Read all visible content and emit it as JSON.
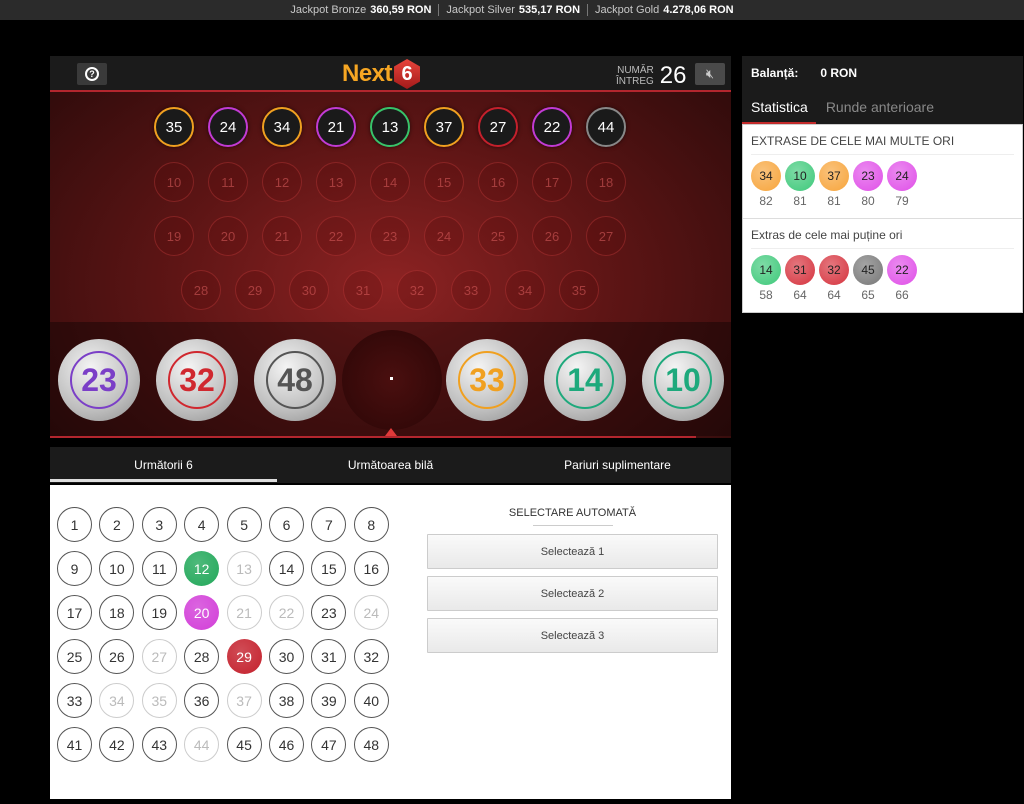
{
  "jackpots": [
    {
      "label": "Jackpot Bronze",
      "value": "360,59 RON"
    },
    {
      "label": "Jackpot Silver",
      "value": "535,17 RON"
    },
    {
      "label": "Jackpot Gold",
      "value": "4.278,06 RON"
    }
  ],
  "game": {
    "logo_text": "Next",
    "logo_number": "6",
    "round_label_1": "Număr",
    "round_label_2": "întreg",
    "round_number": "26",
    "help_icon": "question-icon",
    "mute_icon": "speaker-muted-icon",
    "drawn_balls": [
      {
        "n": "35",
        "color": "#f0a020"
      },
      {
        "n": "24",
        "color": "#c23bd4"
      },
      {
        "n": "34",
        "color": "#f0a020"
      },
      {
        "n": "21",
        "color": "#c23bd4"
      },
      {
        "n": "13",
        "color": "#38c36a"
      },
      {
        "n": "37",
        "color": "#f0a020"
      },
      {
        "n": "27",
        "color": "#c4202c"
      },
      {
        "n": "22",
        "color": "#c23bd4"
      },
      {
        "n": "44",
        "color": "#888888"
      }
    ],
    "slots_row1": [
      "10",
      "11",
      "12",
      "13",
      "14",
      "15",
      "16",
      "17",
      "18"
    ],
    "slots_row2": [
      "19",
      "20",
      "21",
      "22",
      "23",
      "24",
      "25",
      "26",
      "27"
    ],
    "slots_row3": [
      "28",
      "29",
      "30",
      "31",
      "32",
      "33",
      "34",
      "35"
    ],
    "tray_balls": [
      {
        "n": "23",
        "color": "#7b3fc7"
      },
      {
        "n": "32",
        "color": "#d0282f"
      },
      {
        "n": "48",
        "color": "#555555"
      },
      {
        "n": "33",
        "color": "#f0a020"
      },
      {
        "n": "14",
        "color": "#1ea97c"
      },
      {
        "n": "10",
        "color": "#1ea97c"
      }
    ]
  },
  "tabs": [
    "Următorii 6",
    "Următoarea bilă",
    "Pariuri suplimentare"
  ],
  "board": {
    "numbers": [
      {
        "n": "1",
        "s": "n"
      },
      {
        "n": "2",
        "s": "n"
      },
      {
        "n": "3",
        "s": "n"
      },
      {
        "n": "4",
        "s": "n"
      },
      {
        "n": "5",
        "s": "n"
      },
      {
        "n": "6",
        "s": "n"
      },
      {
        "n": "7",
        "s": "n"
      },
      {
        "n": "8",
        "s": "n"
      },
      {
        "n": "9",
        "s": "n"
      },
      {
        "n": "10",
        "s": "n"
      },
      {
        "n": "11",
        "s": "n"
      },
      {
        "n": "12",
        "s": "sel",
        "color": "#22a85a"
      },
      {
        "n": "13",
        "s": "dim"
      },
      {
        "n": "14",
        "s": "n"
      },
      {
        "n": "15",
        "s": "n"
      },
      {
        "n": "16",
        "s": "n"
      },
      {
        "n": "17",
        "s": "n"
      },
      {
        "n": "18",
        "s": "n"
      },
      {
        "n": "19",
        "s": "n"
      },
      {
        "n": "20",
        "s": "sel",
        "color": "#d23ed8"
      },
      {
        "n": "21",
        "s": "dim"
      },
      {
        "n": "22",
        "s": "dim"
      },
      {
        "n": "23",
        "s": "n"
      },
      {
        "n": "24",
        "s": "dim"
      },
      {
        "n": "25",
        "s": "n"
      },
      {
        "n": "26",
        "s": "n"
      },
      {
        "n": "27",
        "s": "dim"
      },
      {
        "n": "28",
        "s": "n"
      },
      {
        "n": "29",
        "s": "sel",
        "color": "#c4202c"
      },
      {
        "n": "30",
        "s": "n"
      },
      {
        "n": "31",
        "s": "n"
      },
      {
        "n": "32",
        "s": "n"
      },
      {
        "n": "33",
        "s": "n"
      },
      {
        "n": "34",
        "s": "dim"
      },
      {
        "n": "35",
        "s": "dim"
      },
      {
        "n": "36",
        "s": "n"
      },
      {
        "n": "37",
        "s": "dim"
      },
      {
        "n": "38",
        "s": "n"
      },
      {
        "n": "39",
        "s": "n"
      },
      {
        "n": "40",
        "s": "n"
      },
      {
        "n": "41",
        "s": "n"
      },
      {
        "n": "42",
        "s": "n"
      },
      {
        "n": "43",
        "s": "n"
      },
      {
        "n": "44",
        "s": "dim"
      },
      {
        "n": "45",
        "s": "n"
      },
      {
        "n": "46",
        "s": "n"
      },
      {
        "n": "47",
        "s": "n"
      },
      {
        "n": "48",
        "s": "n"
      }
    ],
    "auto_title": "SELECTARE AUTOMATĂ",
    "auto_buttons": [
      "Selectează 1",
      "Selectează 2",
      "Selectează 3"
    ]
  },
  "side": {
    "balance_label": "Balanță:",
    "balance_value": "0 RON",
    "tabs": [
      "Statistica",
      "Runde anterioare"
    ],
    "most_title": "EXTRASE DE CELE MAI MULTE ORI",
    "most": [
      {
        "n": "34",
        "c": "82",
        "color": "#f7a43a"
      },
      {
        "n": "10",
        "c": "81",
        "color": "#3ec97a"
      },
      {
        "n": "37",
        "c": "81",
        "color": "#f7a43a"
      },
      {
        "n": "23",
        "c": "80",
        "color": "#e04fe8"
      },
      {
        "n": "24",
        "c": "79",
        "color": "#e04fe8"
      }
    ],
    "least_title": "Extras de cele mai puține ori",
    "least": [
      {
        "n": "14",
        "c": "58",
        "color": "#3ec97a"
      },
      {
        "n": "31",
        "c": "64",
        "color": "#d6333e"
      },
      {
        "n": "32",
        "c": "64",
        "color": "#d6333e"
      },
      {
        "n": "45",
        "c": "65",
        "color": "#777777"
      },
      {
        "n": "22",
        "c": "66",
        "color": "#e04fe8"
      }
    ]
  }
}
